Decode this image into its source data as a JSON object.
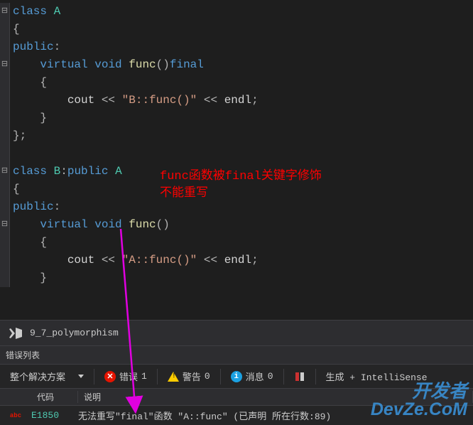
{
  "code": {
    "classA": {
      "decl": {
        "kw_class": "class",
        "name": "A"
      },
      "open": "{",
      "public": "public",
      "func_decl": {
        "kw_virtual": "virtual",
        "kw_void": "void",
        "name": "func",
        "parens": "()",
        "kw_final": "final"
      },
      "body_open": "{",
      "cout": {
        "obj": "cout",
        "op1": "<<",
        "str": "\"B::func()\"",
        "op2": "<<",
        "endl": "endl",
        "semi": ";"
      },
      "body_close": "}",
      "close": "};"
    },
    "classB": {
      "decl": {
        "kw_class": "class",
        "name": "B",
        "colon": ":",
        "kw_public": "public",
        "base": "A"
      },
      "open": "{",
      "public": "public",
      "func_decl": {
        "kw_virtual": "virtual",
        "kw_void": "void",
        "name": "func",
        "parens": "()"
      },
      "body_open": "{",
      "cout": {
        "obj": "cout",
        "op1": "<<",
        "str": "\"A::func()\"",
        "op2": "<<",
        "endl": "endl",
        "semi": ";"
      },
      "body_close": "}"
    }
  },
  "annotation": {
    "line1": "func函数被final关键字修饰",
    "line2": "不能重写"
  },
  "tab": {
    "label": "9_7_polymorphism"
  },
  "errorList": {
    "title": "错误列表",
    "scope": "整个解决方案",
    "errors_label": "错误",
    "errors_count": "1",
    "warnings_label": "警告",
    "warnings_count": "0",
    "messages_label": "消息",
    "messages_count": "0",
    "build_label": "生成 + IntelliSense",
    "cols": {
      "code": "代码",
      "desc": "说明"
    },
    "row": {
      "code": "E1850",
      "desc": "无法重写\"final\"函数 \"A::func\" (已声明 所在行数:89)"
    }
  },
  "watermark": {
    "line1": "开发者",
    "line2": "DevZe.CoM"
  }
}
